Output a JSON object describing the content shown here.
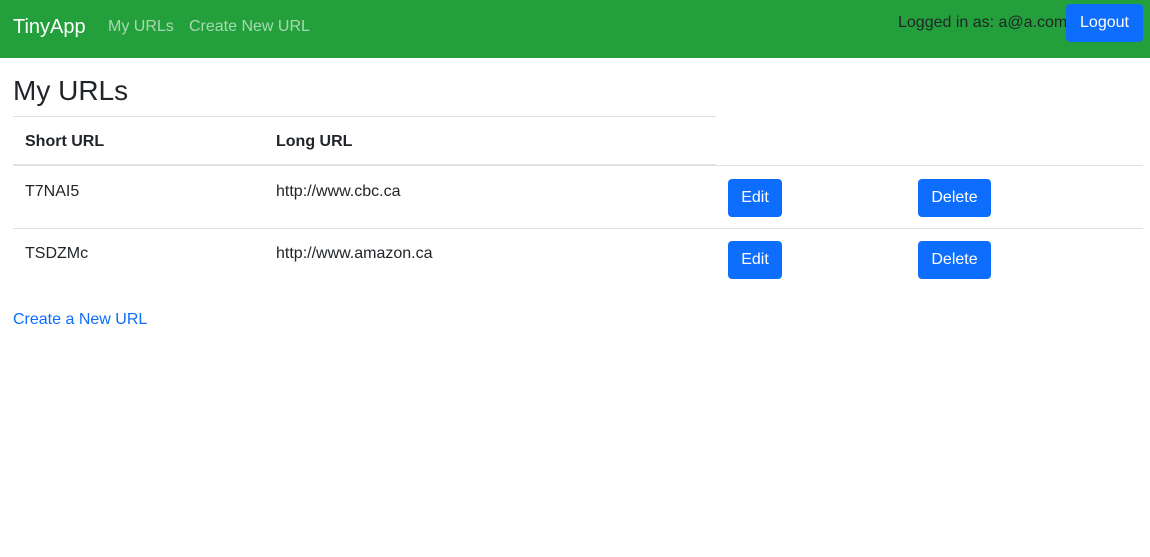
{
  "navbar": {
    "brand": "TinyApp",
    "links": [
      {
        "label": "My URLs"
      },
      {
        "label": "Create New URL"
      }
    ],
    "logged_in_text": "Logged in as: a@a.com",
    "logout_label": "Logout"
  },
  "main": {
    "title": "My URLs",
    "table": {
      "columns": [
        "Short URL",
        "Long URL"
      ],
      "rows": [
        {
          "short": "T7NAI5",
          "long": "http://www.cbc.ca",
          "edit_label": "Edit",
          "delete_label": "Delete"
        },
        {
          "short": "TSDZMc",
          "long": "http://www.amazon.ca",
          "edit_label": "Edit",
          "delete_label": "Delete"
        }
      ]
    },
    "create_link": "Create a New URL"
  },
  "colors": {
    "navbar_bg": "#23a03c",
    "primary": "#0d6efd",
    "border": "#dee2e6",
    "text": "#212529"
  }
}
